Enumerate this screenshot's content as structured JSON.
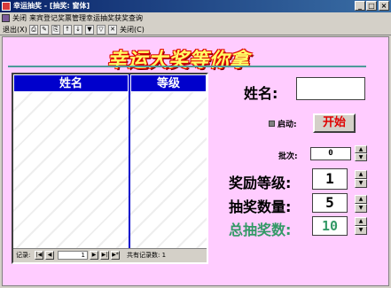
{
  "window": {
    "title": "幸运抽奖 - [抽奖: 窗体]",
    "controls": [
      "_",
      "□",
      "×"
    ]
  },
  "menu": {
    "items": [
      "关闭",
      "来宾登记",
      "奖票管理",
      "幸运抽奖",
      "获奖查询"
    ]
  },
  "toolbar": {
    "exit_label": "退出(X)",
    "close_label": "关闭(C)",
    "icons": [
      "print-preview-icon",
      "design-view-icon",
      "print-icon",
      "sort-ascending-icon",
      "sort-descending-icon",
      "filter-icon",
      "toggle-filter-icon",
      "close-icon"
    ]
  },
  "form": {
    "banner": "幸运大奖等你拿",
    "list": {
      "columns": [
        "姓名",
        "等级"
      ],
      "rows": []
    },
    "navigator": {
      "record_label": "记录:",
      "current": "1",
      "total_label": "共有记录数: 1",
      "buttons": [
        "|◀",
        "◀",
        "▶",
        "▶|",
        "▶*"
      ]
    },
    "name_label": "姓名:",
    "name_value": "",
    "start_label": "启动:",
    "start_checked": false,
    "start_button": "开始",
    "batch_label": "批次:",
    "batch_value": "0",
    "prize_level_label": "奖励等级:",
    "prize_level_value": "1",
    "draw_count_label": "抽奖数量:",
    "draw_count_value": "5",
    "total_draws_label": "总抽奖数:",
    "total_draws_value": "10"
  },
  "colors": {
    "form_background": "#ffccff",
    "column_header": "#0000cc",
    "banner_text": "#ffff66",
    "banner_outline": "#e00000",
    "start_button_text": "#e00000",
    "total_draws_label": "#339966"
  }
}
